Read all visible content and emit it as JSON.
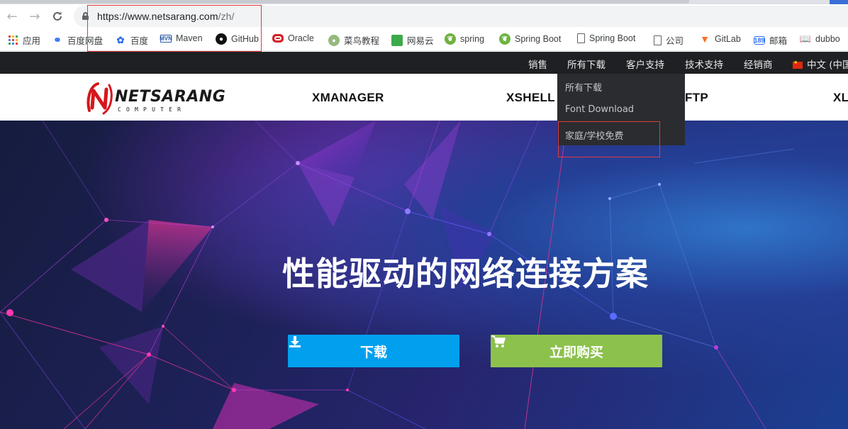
{
  "browser": {
    "url_main": "https://www.netsarang.com",
    "url_path": "/zh/",
    "bookmarks": [
      {
        "label": "应用",
        "icon": "apps-grid-icon"
      },
      {
        "label": "百度网盘",
        "icon": "baidu-netdisk-icon"
      },
      {
        "label": "百度",
        "icon": "baidu-paw-icon"
      },
      {
        "label": "Maven",
        "icon": "maven-icon"
      },
      {
        "label": "GitHub",
        "icon": "github-icon"
      },
      {
        "label": "Oracle",
        "icon": "oracle-icon"
      },
      {
        "label": "菜鸟教程",
        "icon": "runoob-icon"
      },
      {
        "label": "网易云",
        "icon": "netease-cloud-icon"
      },
      {
        "label": "spring",
        "icon": "spring-leaf-icon"
      },
      {
        "label": "Spring Boot",
        "icon": "spring-leaf-icon"
      },
      {
        "label": "Spring Boot",
        "icon": "page-icon"
      },
      {
        "label": "公司",
        "icon": "page-icon"
      },
      {
        "label": "GitLab",
        "icon": "gitlab-icon"
      },
      {
        "label": "邮箱",
        "icon": "mail-189-icon"
      },
      {
        "label": "dubbo",
        "icon": "book-icon"
      }
    ]
  },
  "topbar": {
    "items": [
      "销售",
      "所有下载",
      "客户支持",
      "技术支持",
      "经销商"
    ],
    "language": "中文 (中国"
  },
  "dropdown": {
    "items": [
      "所有下载",
      "Font Download",
      "家庭/学校免费"
    ]
  },
  "logo": {
    "name": "NETSARANG",
    "sub": "COMPUTER"
  },
  "products": [
    "XMANAGER",
    "XSHELL",
    "FTP",
    "XL"
  ],
  "hero": {
    "title": "性能驱动的网络连接方案",
    "download_label": "下载",
    "buy_label": "立即购买"
  },
  "colors": {
    "download": "#00a0ee",
    "buy": "#8cc14c",
    "topbar": "#1e2023",
    "highlight_box": "#e23b3b"
  }
}
